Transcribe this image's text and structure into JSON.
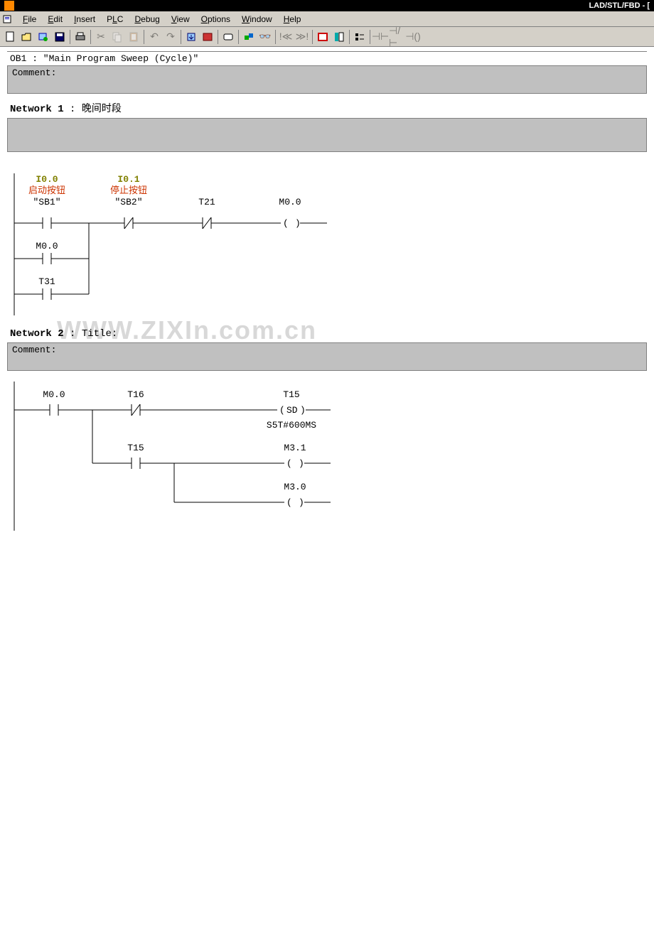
{
  "titleBar": {
    "appTitleRight": "LAD/STL/FBD - ["
  },
  "menu": {
    "file": "File",
    "edit": "Edit",
    "insert": "Insert",
    "plc": "PLC",
    "debug": "Debug",
    "view": "View",
    "options": "Options",
    "window": "Window",
    "help": "Help"
  },
  "ob": {
    "header": "OB1 : \"Main Program Sweep (Cycle)\"",
    "commentLabel": "Comment:"
  },
  "network1": {
    "prefix": "Network 1",
    "title": "晚间时段",
    "contacts": {
      "c1": {
        "addr": "I0.0",
        "desc": "启动按钮",
        "sym": "\"SB1\""
      },
      "c2": {
        "addr": "I0.1",
        "desc": "停止按钮",
        "sym": "\"SB2\""
      },
      "c3": {
        "addr": "T21"
      },
      "coil": {
        "addr": "M0.0"
      },
      "branch1": {
        "addr": "M0.0"
      },
      "branch2": {
        "addr": "T31"
      }
    }
  },
  "network2": {
    "prefix": "Network 2",
    "title": "Title:",
    "commentLabel": "Comment:",
    "contacts": {
      "c1": {
        "addr": "M0.0"
      },
      "c2": {
        "addr": "T16"
      },
      "timer": {
        "addr": "T15",
        "type": "SD",
        "preset": "S5T#600MS"
      },
      "c3": {
        "addr": "T15"
      },
      "coil1": {
        "addr": "M3.1"
      },
      "coil2": {
        "addr": "M3.0"
      }
    }
  },
  "watermark": "WWW.ZIXIn.com.cn"
}
